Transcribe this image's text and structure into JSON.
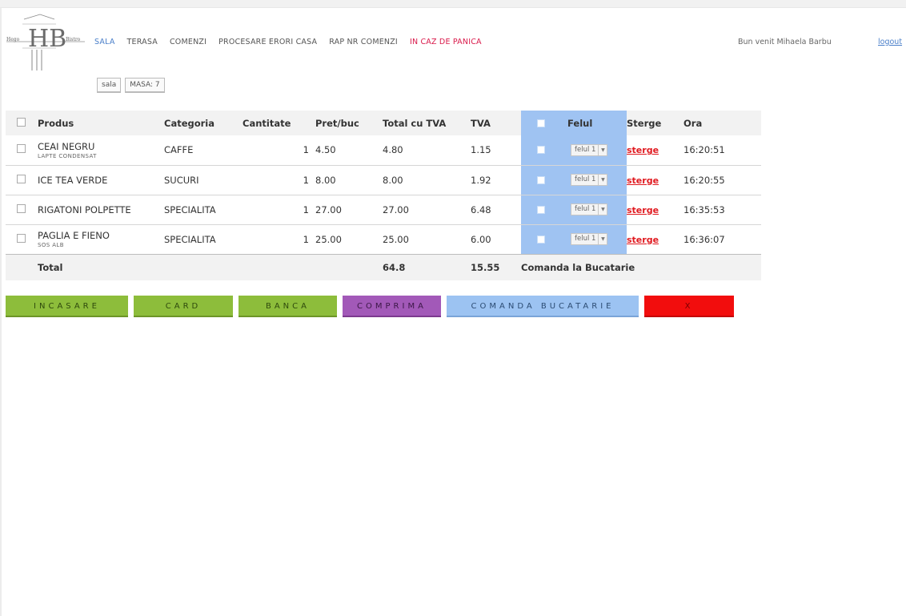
{
  "brand": {
    "logo_initials": "HB",
    "logo_side_text_left": "Hego",
    "logo_side_text_right": "Bistro"
  },
  "nav": {
    "items": [
      {
        "label": "SALA",
        "state": "active"
      },
      {
        "label": "TERASA",
        "state": ""
      },
      {
        "label": "COMENZI",
        "state": ""
      },
      {
        "label": "PROCESARE ERORI CASA",
        "state": ""
      },
      {
        "label": "RAP NR COMENZI",
        "state": ""
      },
      {
        "label": "IN CAZ DE PANICA",
        "state": "panic"
      }
    ],
    "welcome": "Bun venit Mihaela Barbu",
    "logout": "logout"
  },
  "breadcrumbs": [
    "sala",
    "MASA: 7"
  ],
  "table": {
    "headers": {
      "produs": "Produs",
      "categoria": "Categoria",
      "cantitate": "Cantitate",
      "pret": "Pret/buc",
      "total": "Total cu TVA",
      "tva": "TVA",
      "felul": "Felul",
      "sterge": "Sterge",
      "ora": "Ora"
    },
    "rows": [
      {
        "produs": "CEAI NEGRU",
        "sub": "LAPTE CONDENSAT",
        "categoria": "CAFFE",
        "cantitate": "1",
        "pret": "4.50",
        "total": "4.80",
        "tva": "1.15",
        "felul": "felul 1",
        "sterge": "sterge",
        "ora": "16:20:51"
      },
      {
        "produs": "ICE TEA VERDE",
        "sub": "",
        "categoria": "SUCURI",
        "cantitate": "1",
        "pret": "8.00",
        "total": "8.00",
        "tva": "1.92",
        "felul": "felul 1",
        "sterge": "sterge",
        "ora": "16:20:55"
      },
      {
        "produs": "RIGATONI POLPETTE",
        "sub": "",
        "categoria": "SPECIALITA",
        "cantitate": "1",
        "pret": "27.00",
        "total": "27.00",
        "tva": "6.48",
        "felul": "felul 1",
        "sterge": "sterge",
        "ora": "16:35:53"
      },
      {
        "produs": "PAGLIA E FIENO",
        "sub": "SOS ALB",
        "categoria": "SPECIALITA",
        "cantitate": "1",
        "pret": "25.00",
        "total": "25.00",
        "tva": "6.00",
        "felul": "felul 1",
        "sterge": "sterge",
        "ora": "16:36:07"
      }
    ],
    "footer": {
      "label": "Total",
      "total": "64.8",
      "tva": "15.55",
      "comanda": "Comanda la Bucatarie"
    }
  },
  "actions": {
    "incasare": "INCASARE",
    "card": "CARD",
    "banca": "BANCA",
    "comprima": "COMPRIMA",
    "comanda_bucatarie": "COMANDA BUCATARIE",
    "x": "X"
  },
  "colors": {
    "accent_blue": "#9fc3f2",
    "green": "#8dbd3b",
    "purple": "#a259b8",
    "red": "#f20d0d",
    "panic": "#d9194a",
    "sterge": "#e0191f"
  }
}
